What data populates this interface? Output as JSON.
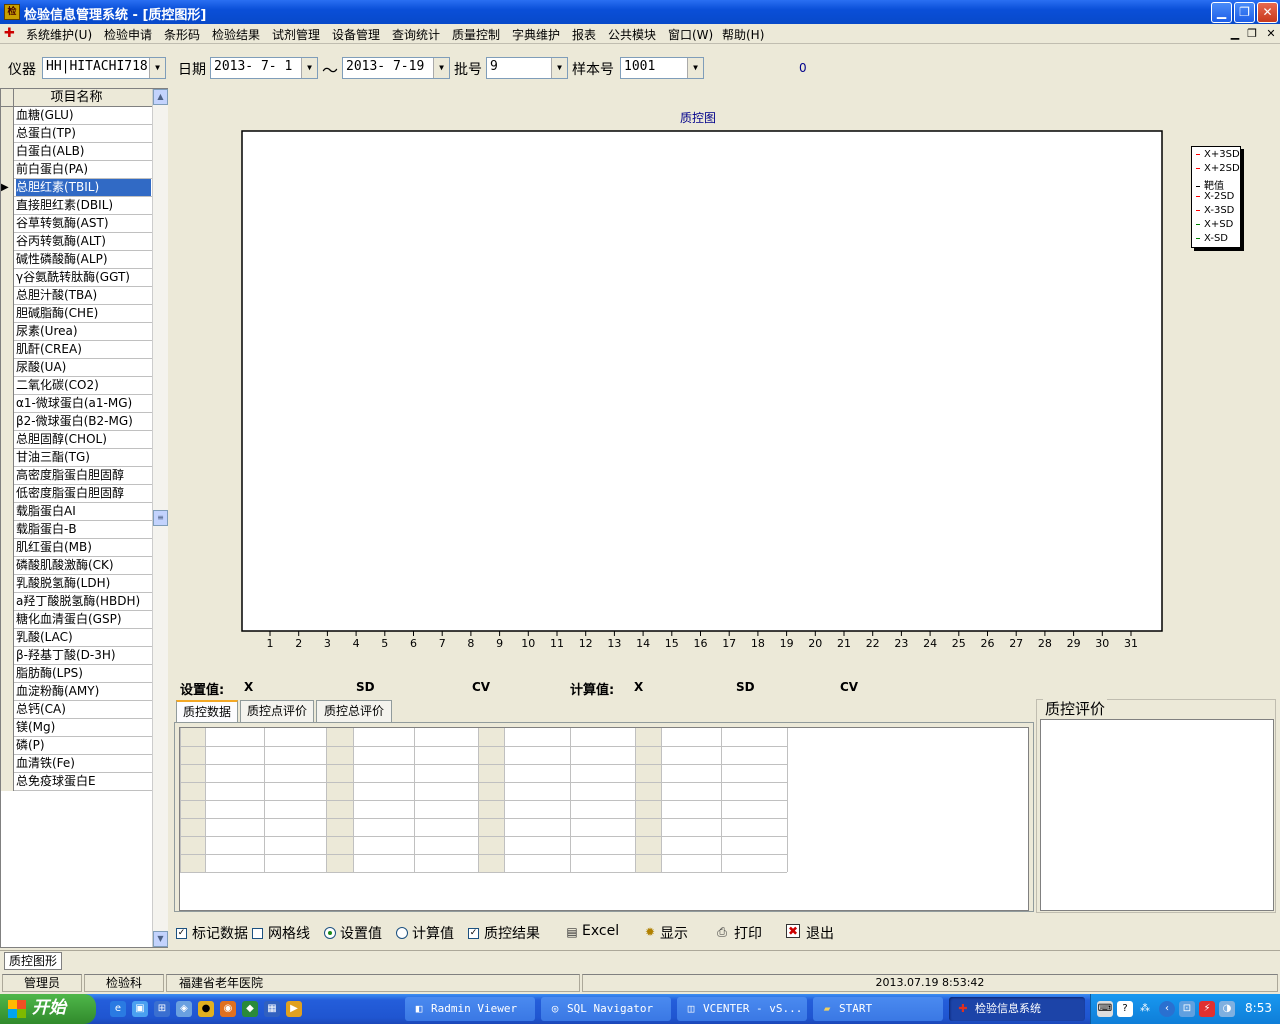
{
  "window": {
    "title": "检验信息管理系统 - [质控图形]"
  },
  "menu": [
    "系统维护(U)",
    "检验申请",
    "条形码",
    "检验结果",
    "试剂管理",
    "设备管理",
    "查询统计",
    "质量控制",
    "字典维护",
    "报表",
    "公共模块",
    "窗口(W)",
    "帮助(H)"
  ],
  "toolbar": {
    "instrument_label": "仪器",
    "instrument_value": "HH|HITACHI718",
    "date_label": "日期",
    "date_from": "2013- 7- 1",
    "date_sep": "〜",
    "date_to": "2013- 7-19",
    "batch_label": "批号",
    "batch_value": "9",
    "sample_label": "样本号",
    "sample_value": "1001",
    "count": "0"
  },
  "list": {
    "header": "项目名称",
    "selected_index": 4,
    "items": [
      "血糖(GLU)",
      "总蛋白(TP)",
      "白蛋白(ALB)",
      "前白蛋白(PA)",
      "总胆红素(TBIL)",
      "直接胆红素(DBIL)",
      "谷草转氨酶(AST)",
      "谷丙转氨酶(ALT)",
      "碱性磷酸酶(ALP)",
      "γ谷氨酰转肽酶(GGT)",
      "总胆汁酸(TBA)",
      "胆碱脂酶(CHE)",
      "尿素(Urea)",
      "肌酐(CREA)",
      "尿酸(UA)",
      "二氧化碳(CO2)",
      "α1-微球蛋白(a1-MG)",
      "β2-微球蛋白(B2-MG)",
      "总胆固醇(CHOL)",
      "甘油三酯(TG)",
      "高密度脂蛋白胆固醇",
      "低密度脂蛋白胆固醇",
      "载脂蛋白AI",
      "载脂蛋白-B",
      "肌红蛋白(MB)",
      "磷酸肌酸激酶(CK)",
      "乳酸脱氢酶(LDH)",
      "a羟丁酸脱氢酶(HBDH)",
      "糖化血清蛋白(GSP)",
      "乳酸(LAC)",
      "β-羟基丁酸(D-3H)",
      "脂肪酶(LPS)",
      "血淀粉酶(AMY)",
      "总钙(CA)",
      "镁(Mg)",
      "磷(P)",
      "血清铁(Fe)",
      "总免疫球蛋白E"
    ]
  },
  "chart_data": {
    "type": "line",
    "title": "质控图",
    "categories": [
      "1",
      "2",
      "3",
      "4",
      "5",
      "6",
      "7",
      "8",
      "9",
      "10",
      "11",
      "12",
      "13",
      "14",
      "15",
      "16",
      "17",
      "18",
      "19",
      "20",
      "21",
      "22",
      "23",
      "24",
      "25",
      "26",
      "27",
      "28",
      "29",
      "30",
      "31"
    ],
    "series": [
      {
        "name": "X+3SD",
        "values": [],
        "color": "#ff0000"
      },
      {
        "name": "X+2SD",
        "values": [],
        "color": "#ff0000"
      },
      {
        "name": "靶值",
        "values": [],
        "color": "#000000"
      },
      {
        "name": "X-2SD",
        "values": [],
        "color": "#ff0000"
      },
      {
        "name": "X-3SD",
        "values": [],
        "color": "#ff0000"
      },
      {
        "name": "X+SD",
        "values": [],
        "color": "#008000"
      },
      {
        "name": "X-SD",
        "values": [],
        "color": "#008000"
      }
    ],
    "legend": "right"
  },
  "stats": {
    "set_label": "设置值:",
    "calc_label": "计算值:",
    "x": "X",
    "sd": "SD",
    "cv": "CV"
  },
  "tabs": [
    "质控数据",
    "质控点评价",
    "质控总评价"
  ],
  "eval_title": "质控评价",
  "controls": {
    "mark_data": "标记数据",
    "gridlines": "网格线",
    "set_value": "设置值",
    "calc_value": "计算值",
    "qc_result": "质控结果",
    "excel": "Excel",
    "display": "显示",
    "print": "打印",
    "exit": "退出"
  },
  "mdi_tab": "质控图形",
  "status": {
    "user": "管理员",
    "dept": "检验科",
    "hospital": "福建省老年医院",
    "datetime": "2013.07.19 8:53:42"
  },
  "taskbar": {
    "start": "开始",
    "tasks": [
      "Radmin Viewer",
      "SQL Navigator",
      "VCENTER - vS...",
      "START",
      "检验信息系统"
    ],
    "clock": "8:53"
  }
}
